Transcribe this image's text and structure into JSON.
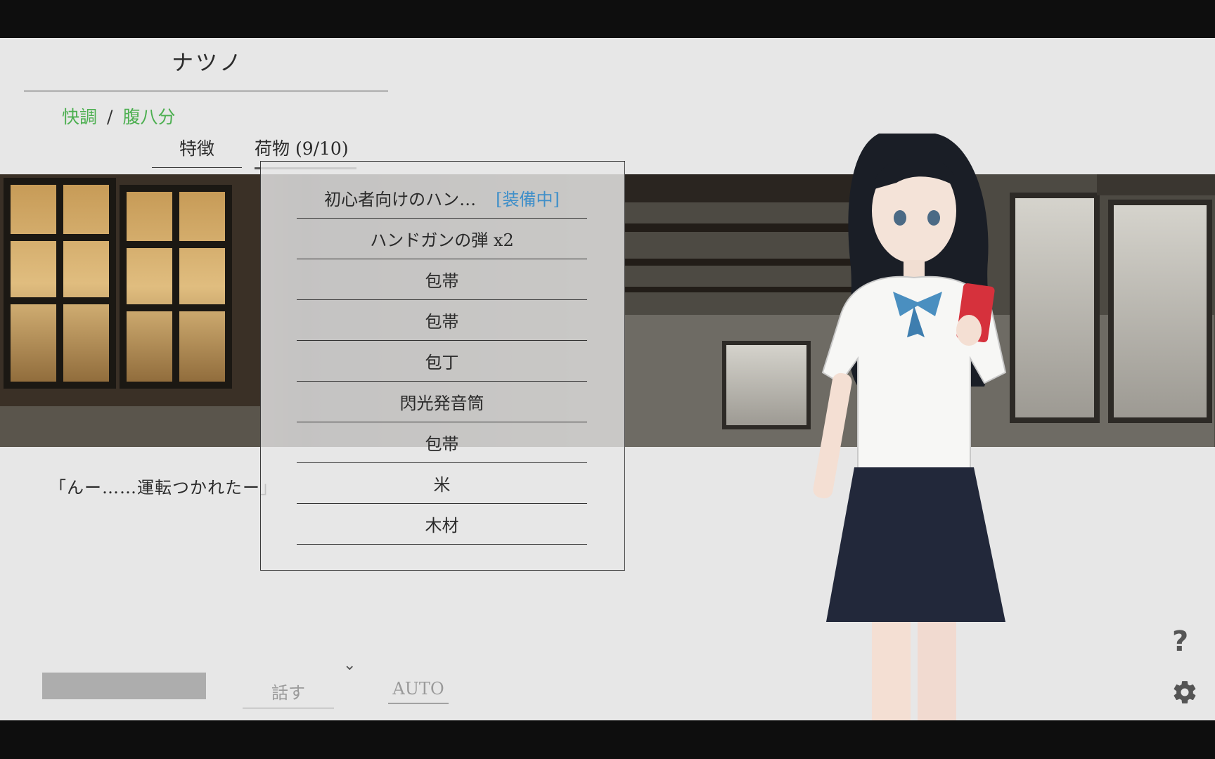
{
  "character": {
    "name": "ナツノ"
  },
  "status": {
    "mood": "快調",
    "separator": "/",
    "hunger": "腹八分"
  },
  "tabs": {
    "traits": "特徴",
    "items": "荷物 (9/10)"
  },
  "inventory": {
    "items": [
      {
        "label": "初心者向けのハン…",
        "tag": "[装備中]"
      },
      {
        "label": "ハンドガンの弾 x2"
      },
      {
        "label": "包帯"
      },
      {
        "label": "包帯"
      },
      {
        "label": "包丁"
      },
      {
        "label": "閃光発音筒"
      },
      {
        "label": "包帯"
      },
      {
        "label": "米"
      },
      {
        "label": "木材"
      }
    ]
  },
  "dialogue": {
    "text": "「んー……運転つかれたー」"
  },
  "controls": {
    "talk": "話す",
    "auto": "AUTO",
    "chevron": "⌄",
    "help": "?",
    "gear_icon": "gear-icon"
  },
  "colors": {
    "status_green": "#4caf50",
    "equipped_blue": "#3f8fc9",
    "background": "#e7e7e7"
  }
}
